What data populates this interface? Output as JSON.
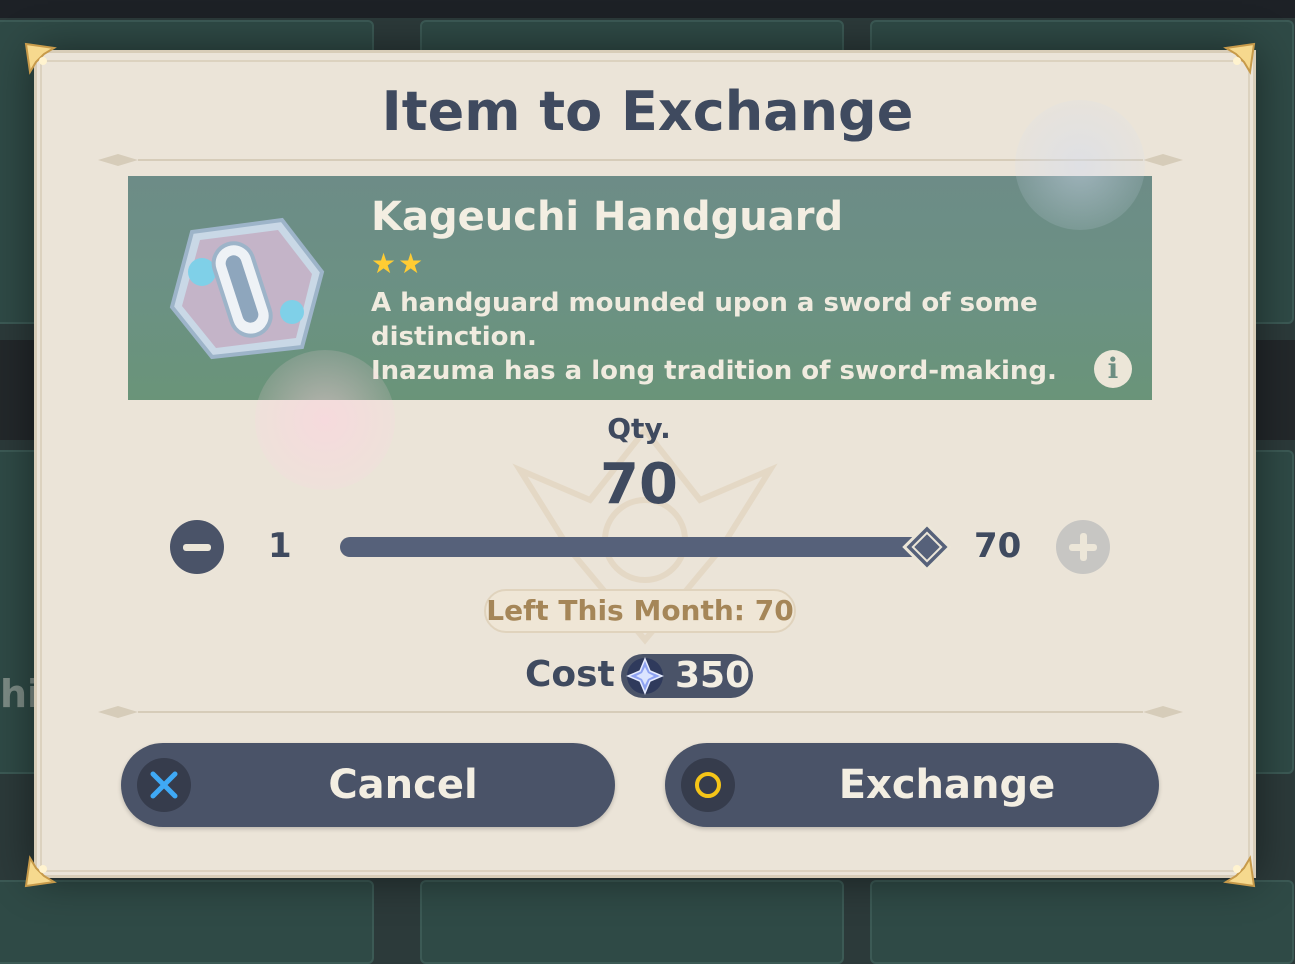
{
  "dialog": {
    "title": "Item to Exchange"
  },
  "item": {
    "name": "Kageuchi Handguard",
    "rarity_stars": 2,
    "star_glyph": "★",
    "description_lines": [
      "A handguard mounded upon a sword of some",
      "distinction.",
      "Inazuma has a long tradition of sword-making."
    ],
    "icon": "handguard-item-icon",
    "info_icon_glyph": "i"
  },
  "quantity": {
    "label": "Qty.",
    "value": "70",
    "slider_min": "1",
    "slider_max": "70",
    "slider_fraction": 1.0
  },
  "limit": {
    "text": "Left This Month: 70"
  },
  "cost": {
    "label": "Cost",
    "value": "350",
    "currency_icon": "starglitter-icon"
  },
  "buttons": {
    "cancel_label": "Cancel",
    "exchange_label": "Exchange"
  },
  "background": {
    "side_text_left": "hi"
  },
  "colors": {
    "panel": "#ebe4d8",
    "accent_dark": "#4a5368",
    "title_text": "#3f4a5f",
    "star": "#ffcc33",
    "limit_text": "#a58658"
  }
}
